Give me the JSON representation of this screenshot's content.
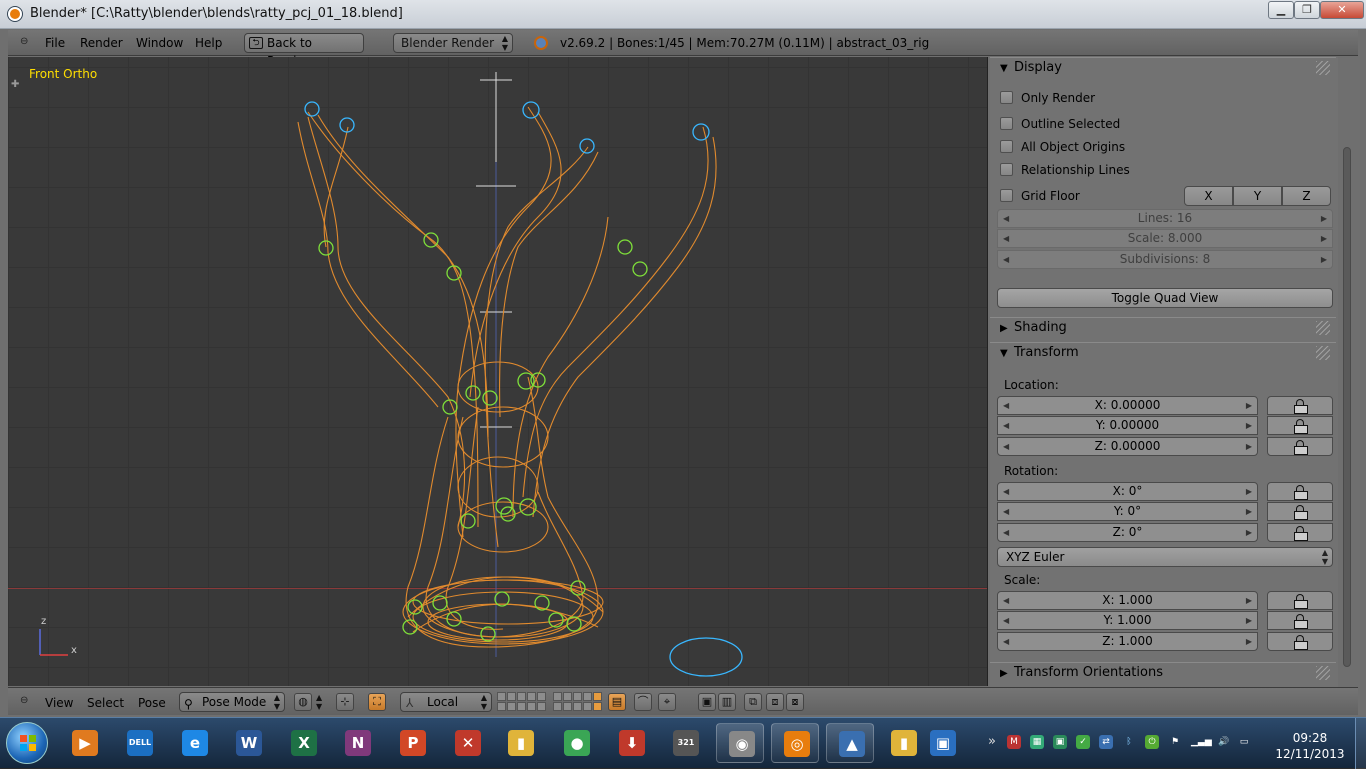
{
  "window": {
    "title": "Blender* [C:\\Ratty\\blender\\blends\\ratty_pcj_01_18.blend]",
    "min_glyph": "▁",
    "max_glyph": "❐",
    "close_glyph": "✕"
  },
  "info_header": {
    "menus": [
      "File",
      "Render",
      "Window",
      "Help"
    ],
    "back_button": "Back to Previous",
    "render_engine": "Blender Render",
    "stats": "v2.69.2 | Bones:1/45  | Mem:70.27M (0.11M) | abstract_03_rig"
  },
  "viewport": {
    "label": "Front Ortho",
    "axis_z": "z",
    "axis_x": "x",
    "colors": {
      "wire": "#e08a2e",
      "bone_selected": "#39b7ff",
      "bone": "#7fe03a"
    }
  },
  "bottom_header": {
    "menus": [
      "View",
      "Select",
      "Pose"
    ],
    "mode": "Pose Mode",
    "orientation": "Local"
  },
  "properties": {
    "display": {
      "header": "Display",
      "options": [
        "Only Render",
        "Outline Selected",
        "All Object Origins",
        "Relationship Lines",
        "Grid Floor"
      ],
      "axes": [
        "X",
        "Y",
        "Z"
      ],
      "lines": "Lines: 16",
      "scale": "Scale: 8.000",
      "subdivisions": "Subdivisions: 8",
      "toggle_quad": "Toggle Quad View"
    },
    "shading": {
      "header": "Shading"
    },
    "transform": {
      "header": "Transform",
      "location_label": "Location:",
      "location": [
        "X: 0.00000",
        "Y: 0.00000",
        "Z: 0.00000"
      ],
      "rotation_label": "Rotation:",
      "rotation": [
        "X: 0°",
        "Y: 0°",
        "Z: 0°"
      ],
      "rotation_mode": "XYZ Euler",
      "scale_label": "Scale:",
      "scale": [
        "X: 1.000",
        "Y: 1.000",
        "Z: 1.000"
      ]
    },
    "transform_orientations": {
      "header": "Transform Orientations"
    }
  },
  "taskbar": {
    "apps": [
      {
        "name": "windows-media-player",
        "glyph": "▶",
        "color": "#e07a1f"
      },
      {
        "name": "dell",
        "glyph": "DELL",
        "color": "#1b6fc2"
      },
      {
        "name": "internet-explorer",
        "glyph": "e",
        "color": "#1e88e5"
      },
      {
        "name": "word",
        "glyph": "W",
        "color": "#2b5797"
      },
      {
        "name": "excel",
        "glyph": "X",
        "color": "#1e7145"
      },
      {
        "name": "onenote",
        "glyph": "N",
        "color": "#80397b"
      },
      {
        "name": "powerpoint",
        "glyph": "P",
        "color": "#d24726"
      },
      {
        "name": "red-app",
        "glyph": "✕",
        "color": "#c0392b"
      },
      {
        "name": "file-explorer",
        "glyph": "▮",
        "color": "#e0b43a"
      },
      {
        "name": "chrome",
        "glyph": "●",
        "color": "#3aa655"
      },
      {
        "name": "downloader",
        "glyph": "⬇",
        "color": "#c0392b"
      },
      {
        "name": "media-321",
        "glyph": "321",
        "color": "#555"
      },
      {
        "name": "speaker-app",
        "glyph": "◉",
        "color": "#888"
      },
      {
        "name": "blender",
        "glyph": "◎",
        "color": "#e87d0d"
      },
      {
        "name": "photo-app",
        "glyph": "▲",
        "color": "#3a6fb0"
      },
      {
        "name": "folder",
        "glyph": "▮",
        "color": "#e0b43a"
      },
      {
        "name": "remote-desktop",
        "glyph": "▣",
        "color": "#2a6fc0"
      }
    ],
    "tray_expand": "»",
    "time": "09:28",
    "date": "12/11/2013"
  }
}
